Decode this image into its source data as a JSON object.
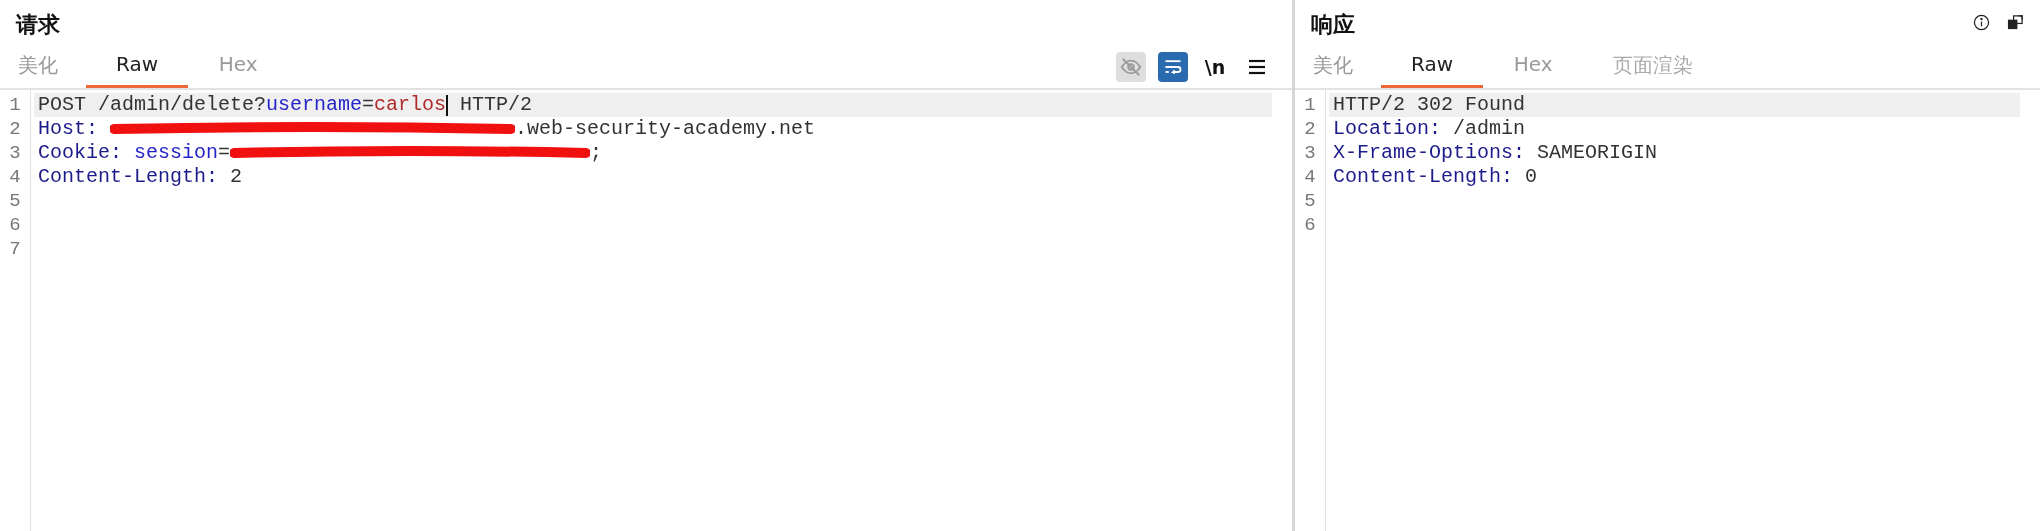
{
  "request": {
    "title": "请求",
    "tabs": [
      {
        "label": "美化",
        "selected": false,
        "disabled": false
      },
      {
        "label": "Raw",
        "selected": true,
        "disabled": false
      },
      {
        "label": "Hex",
        "selected": false,
        "disabled": false
      }
    ],
    "toolbar": [
      {
        "kind": "eye",
        "on": false,
        "disabled": true
      },
      {
        "kind": "wrap",
        "on": true,
        "disabled": false
      },
      {
        "kind": "text",
        "label": "\\n",
        "on": false,
        "disabled": false
      },
      {
        "kind": "menu",
        "on": false,
        "disabled": false
      }
    ],
    "lines": [
      {
        "number": "1",
        "selected": true,
        "segments": [
          {
            "kind": "plain",
            "text": "POST /admin/delete?"
          },
          {
            "kind": "param",
            "text": "username"
          },
          {
            "kind": "plain",
            "text": "="
          },
          {
            "kind": "value",
            "text": "carlos"
          },
          {
            "kind": "caret"
          },
          {
            "kind": "plain",
            "text": " HTTP/2"
          }
        ]
      },
      {
        "number": "2",
        "selected": false,
        "segments": [
          {
            "kind": "header",
            "text": "Host: "
          },
          {
            "kind": "redacted"
          },
          {
            "kind": "plain",
            "text": ".web-security-academy.net"
          }
        ]
      },
      {
        "number": "3",
        "selected": false,
        "segments": [
          {
            "kind": "header",
            "text": "Cookie: "
          },
          {
            "kind": "param",
            "text": "session"
          },
          {
            "kind": "plain",
            "text": "="
          },
          {
            "kind": "redacted"
          },
          {
            "kind": "plain",
            "text": ";"
          }
        ]
      },
      {
        "number": "4",
        "selected": false,
        "segments": [
          {
            "kind": "header",
            "text": "Content-Length:"
          },
          {
            "kind": "plain",
            "text": " 2"
          }
        ]
      },
      {
        "number": "5",
        "selected": false
      },
      {
        "number": "6",
        "selected": false
      },
      {
        "number": "7",
        "selected": false
      }
    ]
  },
  "response": {
    "title": "响应",
    "tabs": [
      {
        "label": "美化",
        "selected": false,
        "disabled": false
      },
      {
        "label": "Raw",
        "selected": true,
        "disabled": false
      },
      {
        "label": "Hex",
        "selected": false,
        "disabled": false
      },
      {
        "label": "页面渲染",
        "selected": false,
        "disabled": true
      }
    ],
    "toolbar": [
      {
        "kind": "info"
      },
      {
        "kind": "popout"
      }
    ],
    "lines": [
      {
        "number": "1",
        "selected": true,
        "segments": [
          {
            "kind": "plain",
            "text": "HTTP/2 302 Found"
          }
        ]
      },
      {
        "number": "2",
        "selected": false,
        "segments": [
          {
            "kind": "header",
            "text": "Location:"
          },
          {
            "kind": "plain",
            "text": " /admin"
          }
        ]
      },
      {
        "number": "3",
        "selected": false,
        "segments": [
          {
            "kind": "header",
            "text": "X-Frame-Options:"
          },
          {
            "kind": "plain",
            "text": " SAMEORIGIN"
          }
        ]
      },
      {
        "number": "4",
        "selected": false,
        "segments": [
          {
            "kind": "header",
            "text": "Content-Length:"
          },
          {
            "kind": "plain",
            "text": " 0"
          }
        ]
      },
      {
        "number": "5",
        "selected": false
      },
      {
        "number": "6",
        "selected": false
      }
    ]
  }
}
